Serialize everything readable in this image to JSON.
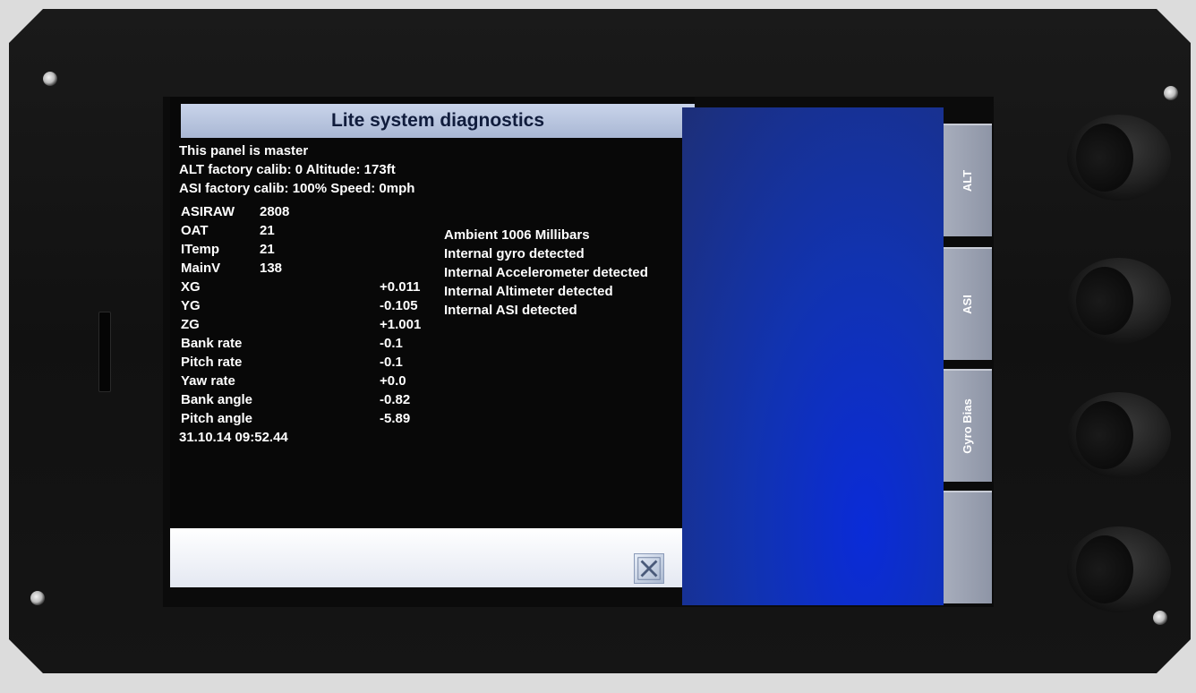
{
  "panel": {
    "title": "Lite system diagnostics",
    "lines": [
      "This panel is master",
      "ALT factory calib: 0 Altitude: 173ft",
      "ASI factory calib: 100%  Speed: 0mph"
    ],
    "grid": [
      {
        "label": "ASIRAW",
        "value": "2808",
        "col": "near"
      },
      {
        "label": "OAT",
        "value": "21",
        "col": "near"
      },
      {
        "label": "ITemp",
        "value": "21",
        "col": "near"
      },
      {
        "label": "MainV",
        "value": "138",
        "col": "near"
      },
      {
        "label": "XG",
        "value": "+0.011",
        "col": "far"
      },
      {
        "label": "YG",
        "value": "-0.105",
        "col": "far"
      },
      {
        "label": "ZG",
        "value": "+1.001",
        "col": "far"
      },
      {
        "label": "Bank rate",
        "value": "-0.1",
        "col": "far"
      },
      {
        "label": "Pitch rate",
        "value": "-0.1",
        "col": "far"
      },
      {
        "label": "Yaw rate",
        "value": "+0.0",
        "col": "far"
      },
      {
        "label": "Bank angle",
        "value": "-0.82",
        "col": "far"
      },
      {
        "label": "Pitch angle",
        "value": "-5.89",
        "col": "far"
      }
    ],
    "status": [
      "Ambient   1006 Millibars",
      "Internal gyro detected",
      "Internal Accelerometer detected",
      "Internal Altimeter detected",
      "Internal ASI detected"
    ],
    "timestamp": "31.10.14 09:52.44"
  },
  "side_buttons": [
    {
      "label": "ALT"
    },
    {
      "label": "ASI"
    },
    {
      "label": "Gyro Bias"
    },
    {
      "label": ""
    }
  ],
  "icons": {
    "close": "close-icon"
  },
  "colors": {
    "title_bar": "#b8c4de",
    "blue_area": "#1133b0",
    "side_button": "#9aa0b0"
  }
}
